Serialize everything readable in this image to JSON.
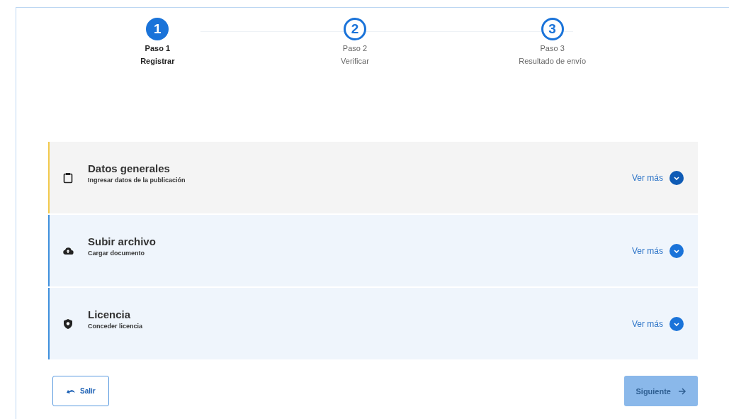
{
  "steps": [
    {
      "number": "1",
      "label": "Paso 1",
      "title": "Registrar",
      "selected": true
    },
    {
      "number": "2",
      "label": "Paso 2",
      "title": "Verificar",
      "selected": false
    },
    {
      "number": "3",
      "label": "Paso 3",
      "title": "Resultado de envío",
      "selected": false
    }
  ],
  "sections": [
    {
      "kind": "clipboard",
      "title": "Datos generales",
      "subtitle": "Ingresar datos de la publicación",
      "action": "Ver más",
      "selected": true
    },
    {
      "kind": "upload",
      "title": "Subir archivo",
      "subtitle": "Cargar documento",
      "action": "Ver más",
      "selected": false
    },
    {
      "kind": "shield",
      "title": "Licencia",
      "subtitle": "Conceder licencia",
      "action": "Ver más",
      "selected": false
    }
  ],
  "buttons": {
    "back": {
      "label": "Salir"
    },
    "next": {
      "label": "Siguiente",
      "disabled": true
    }
  }
}
